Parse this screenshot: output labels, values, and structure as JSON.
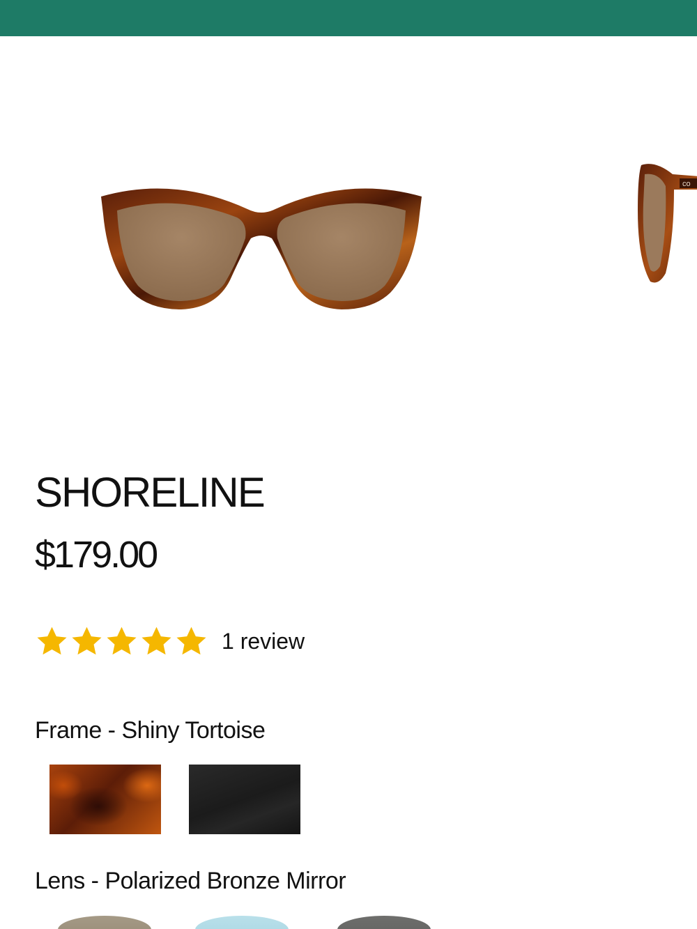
{
  "colors": {
    "top_bar": "#1e7b66",
    "star": "#f5b700",
    "text": "#111111"
  },
  "gallery": {
    "main_image_icon": "sunglasses-front-image",
    "next_image_icon": "sunglasses-side-image",
    "next_image_temple_text": "co"
  },
  "product": {
    "title": "SHORELINE",
    "price": "$179.00",
    "rating": {
      "stars": 5,
      "max_stars": 5,
      "review_count_label": "1 review"
    }
  },
  "options": {
    "frame": {
      "label": "Frame - Shiny Tortoise",
      "swatches": [
        {
          "name": "Shiny Tortoise",
          "selected": true
        },
        {
          "name": "Black",
          "selected": false
        }
      ]
    },
    "lens": {
      "label": "Lens - Polarized Bronze Mirror",
      "swatches": [
        {
          "name": "Polarized Bronze Mirror",
          "color": "#9a8e78",
          "selected": true
        },
        {
          "name": "Blue",
          "color": "#aed8e4",
          "selected": false
        },
        {
          "name": "Gray",
          "color": "#646462",
          "selected": false
        }
      ]
    }
  }
}
